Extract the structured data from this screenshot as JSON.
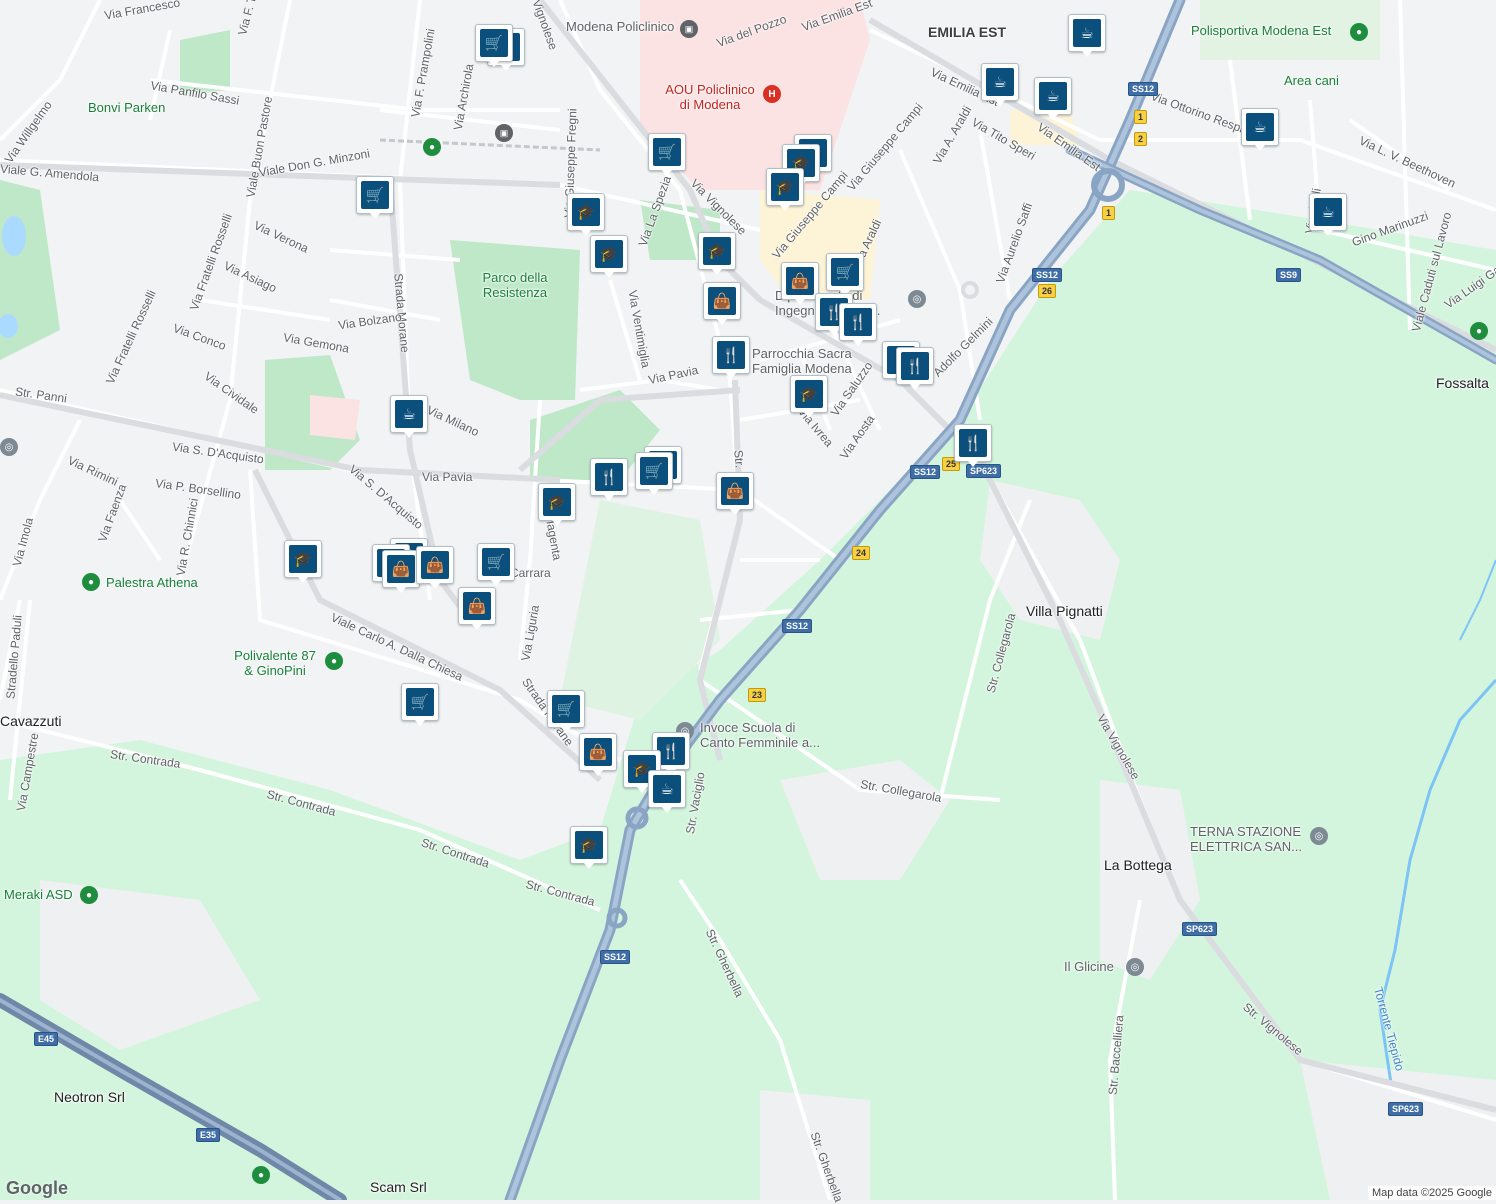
{
  "map": {
    "streets": [
      "Via Francesco",
      "Via F. Ta",
      "Via Vignolese",
      "Modena Policlinico",
      "Via del Pozzo",
      "Via Emilia Est",
      "EMILIA EST",
      "Via Panfilo Sassi",
      "Viale Buon Pastore",
      "Via F. Prampolini",
      "Via Archirola",
      "Via Willgelmo",
      "Viale G. Amendola",
      "Viale Don G. Minzoni",
      "Via Giuseppe Fregni",
      "Via La Spezia",
      "Via Vignolese",
      "Via Giuseppe Campi",
      "Via Giuseppe Campi",
      "Via A. Araldi",
      "Via Tito Speri",
      "Via Emilia Est",
      "Via Emilia Est",
      "Via Ottorino Respighi",
      "Via L. V. Beethoven",
      "Gino Marinuzzi",
      "Via degli",
      "Viale Caduti sul Lavoro",
      "Via Luigi Ga",
      "Via Aurelio Saffi",
      "Via Fratelli Rosselli",
      "Via Verona",
      "Via Asiago",
      "Strada Morane",
      "Via Bolzano",
      "Via Conco",
      "Via Gemona",
      "Via Fratelli Rosselli",
      "Via Cividale",
      "Str. Panni",
      "Via Milano",
      "Via S. D'Acquisto",
      "Via Pavia",
      "Via Pavia",
      "Via S. D'Acquisto",
      "Via Rimini",
      "Via P. Borsellino",
      "Via Faenza",
      "Via R. Chinnici",
      "Via Imola",
      "Via Ventimiglia",
      "Via Saluzzo",
      "Via Ivrea",
      "Via Aosta",
      "Via Magenta",
      "Str.",
      "Carrara",
      "Via Liguria",
      "Viale Carlo A. Dalla Chiesa",
      "Stradello Paduli",
      "Strada Morane",
      "Str. Contrada",
      "Str. Contrada",
      "Str. Contrada",
      "Str. Contrada",
      "Via Campestre",
      "Str. Vaciglio",
      "Str. Collegarola",
      "Str. Collegarola",
      "Via Vignolese",
      "Str. Gherbella",
      "Str. Gherbella",
      "Str. Vignolese",
      "Str. Baccelliera",
      "Torrente Tiepido",
      "Via Araldi",
      "Adolfo Gelmini"
    ],
    "places": [
      "Villa Pignatti",
      "La Bottega",
      "Neotron Srl",
      "Scam Srl",
      "Cavazzuti",
      "Fossalta"
    ],
    "green_labels": [
      "Bonvi Parken",
      "Parco della Resistenza",
      "Polisportiva Modena Est",
      "Area cani",
      "Palestra Athena",
      "Polivalente 87 & GinoPini",
      "Meraki ASD"
    ],
    "pois": [
      "AOU Policlinico di Modena",
      "Parrocchia Sacra Famiglia Modena",
      "Dipartimento di Ingegneria Enzo...",
      "Invoce Scuola di Canto Femminile a...",
      "TERNA STAZIONE ELETTRICA SAN...",
      "Il Glicine"
    ],
    "route_shields": [
      "SS12",
      "SS12",
      "SS12",
      "SS12",
      "SS12",
      "SS9",
      "SP623",
      "SP623",
      "SP623",
      "E45",
      "E35"
    ],
    "road_numbers": [
      "1",
      "2",
      "1",
      "26",
      "25",
      "24",
      "23"
    ],
    "pin_types": {
      "coffee": "cup-icon",
      "shop": "shopping-cart-icon",
      "school": "graduation-cap-icon",
      "bag": "shopping-bag-icon",
      "food": "fork-knife-icon"
    },
    "colors": {
      "background": "#f1f3f4",
      "green_area": "#d4f5dd",
      "park": "#bfe8c9",
      "hospital": "#fbe3e3",
      "highway": "#8aa5c4",
      "pin": "#0b4f7c"
    }
  },
  "attribution": {
    "logo": "Google",
    "text": "Map data ©2025 Google"
  }
}
